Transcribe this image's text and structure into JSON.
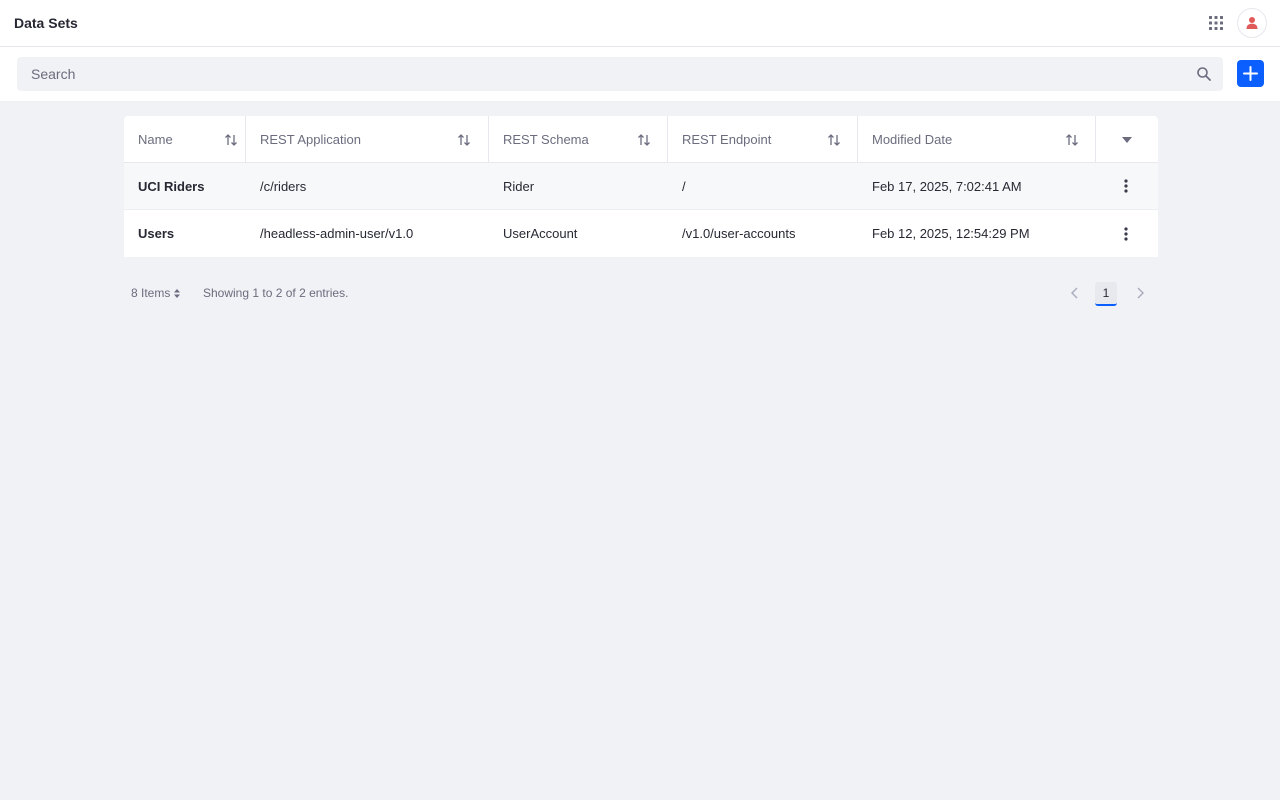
{
  "header": {
    "title": "Data Sets",
    "apps_icon": "grid-apps-icon",
    "avatar_icon": "user-icon",
    "avatar_color": "#e05a5a"
  },
  "search": {
    "placeholder": "Search",
    "value": "",
    "icon": "search-icon",
    "add_icon": "plus-icon",
    "add_color": "#0b5fff"
  },
  "table": {
    "columns": [
      {
        "label": "Name",
        "sortable": true
      },
      {
        "label": "REST Application",
        "sortable": true
      },
      {
        "label": "REST Schema",
        "sortable": true
      },
      {
        "label": "REST Endpoint",
        "sortable": true
      },
      {
        "label": "Modified Date",
        "sortable": true
      }
    ],
    "rows": [
      {
        "name": "UCI Riders",
        "rest_application": "/c/riders",
        "rest_schema": "Rider",
        "rest_endpoint": "/",
        "modified_date": "Feb 17, 2025, 7:02:41 AM"
      },
      {
        "name": "Users",
        "rest_application": "/headless-admin-user/v1.0",
        "rest_schema": "UserAccount",
        "rest_endpoint": "/v1.0/user-accounts",
        "modified_date": "Feb 12, 2025, 12:54:29 PM"
      }
    ]
  },
  "pagination": {
    "items_per_page": "8 Items",
    "entries_text": "Showing 1 to 2 of 2 entries.",
    "current_page": "1"
  }
}
